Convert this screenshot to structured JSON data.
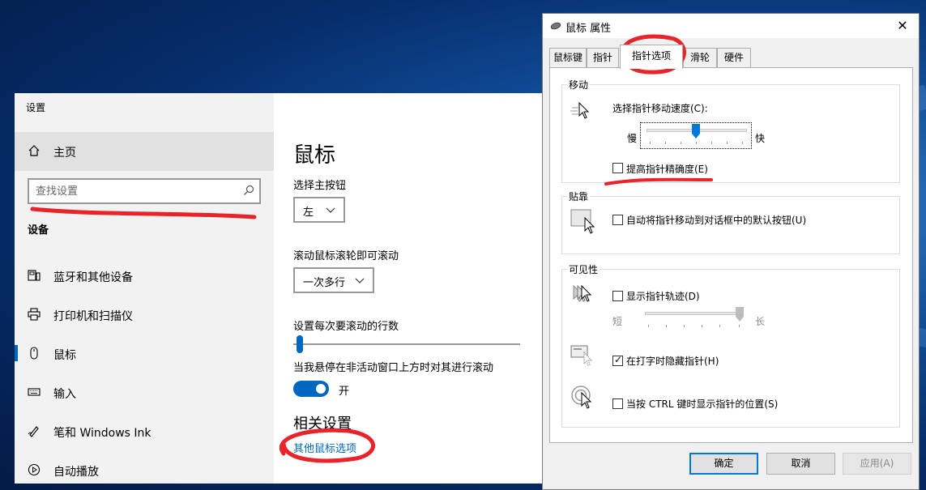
{
  "settings": {
    "window_title": "设置",
    "home_label": "主页",
    "search_placeholder": "查找设置",
    "section_label": "设备",
    "nav_items": [
      {
        "label": "蓝牙和其他设备",
        "icon": "bluetooth-devices-icon"
      },
      {
        "label": "打印机和扫描仪",
        "icon": "printer-icon"
      },
      {
        "label": "鼠标",
        "icon": "mouse-icon",
        "active": true
      },
      {
        "label": "输入",
        "icon": "keyboard-icon"
      },
      {
        "label": "笔和 Windows Ink",
        "icon": "pen-icon"
      },
      {
        "label": "自动播放",
        "icon": "autoplay-icon"
      }
    ],
    "page_title": "鼠标",
    "primary_button_label": "选择主按钮",
    "primary_button_value": "左",
    "scroll_label": "滚动鼠标滚轮即可滚动",
    "scroll_value": "一次多行",
    "lines_label": "设置每次要滚动的行数",
    "lines_value": 3,
    "inactive_scroll_label": "当我悬停在非活动窗口上方时对其进行滚动",
    "toggle_state": "开",
    "related_heading": "相关设置",
    "related_link": "其他鼠标选项"
  },
  "dialog": {
    "title": "鼠标 属性",
    "close_glyph": "✕",
    "tabs": [
      "鼠标键",
      "指针",
      "指针选项",
      "滑轮",
      "硬件"
    ],
    "selected_tab": "指针选项",
    "motion": {
      "group_title": "移动",
      "speed_label": "选择指针移动速度(C):",
      "slow_label": "慢",
      "fast_label": "快",
      "speed_level": 0.6,
      "precision_label": "提高指针精确度(E)",
      "precision_checked": false
    },
    "snap": {
      "group_title": "贴靠",
      "snap_label": "自动将指针移动到对话框中的默认按钮(U)",
      "snap_checked": false
    },
    "visibility": {
      "group_title": "可见性",
      "trails_label": "显示指针轨迹(D)",
      "trails_checked": false,
      "short_label": "短",
      "long_label": "长",
      "trail_level": 1.0,
      "hide_typing_label": "在打字时隐藏指针(H)",
      "hide_typing_checked": true,
      "ctrl_label": "当按 CTRL 键时显示指针的位置(S)",
      "ctrl_checked": false
    },
    "buttons": {
      "ok": "确定",
      "cancel": "取消",
      "apply": "应用(A)"
    }
  },
  "colors": {
    "accent": "#0067c0",
    "annotation": "#e8242a",
    "default_button_border": "#0078d7"
  }
}
